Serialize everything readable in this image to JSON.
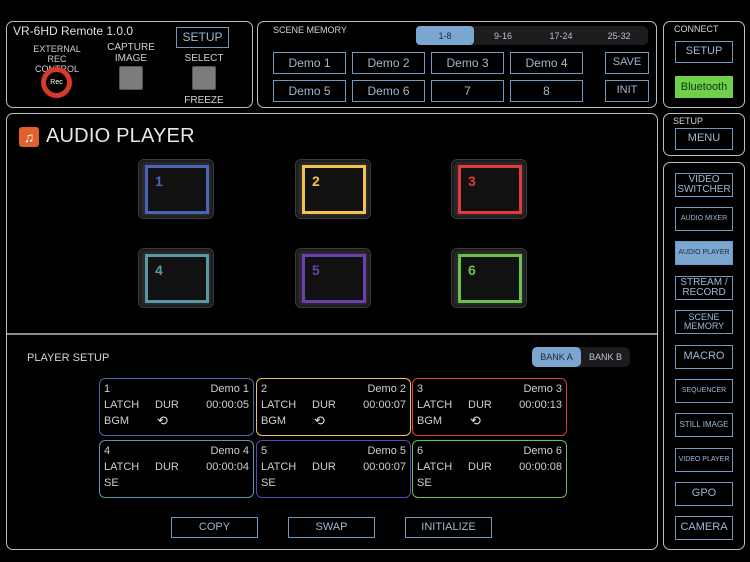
{
  "remote": {
    "title": "VR-6HD Remote 1.0.0",
    "setup_label": "SETUP",
    "external_rec_label_1": "EXTERNAL",
    "external_rec_label_2": "REC CONTROL",
    "rec_label": "Rec",
    "capture_label_1": "CAPTURE",
    "capture_label_2": "IMAGE",
    "select_label": "SELECT",
    "freeze_label": "FREEZE"
  },
  "scene_memory": {
    "title": "SCENE MEMORY",
    "tabs": [
      {
        "label": "1-8",
        "active": true
      },
      {
        "label": "9-16",
        "active": false
      },
      {
        "label": "17-24",
        "active": false
      },
      {
        "label": "25-32",
        "active": false
      }
    ],
    "scenes": [
      "Demo 1",
      "Demo 2",
      "Demo 3",
      "Demo 4",
      "Demo 5",
      "Demo 6",
      "7",
      "8"
    ],
    "save_label": "SAVE",
    "init_label": "INIT"
  },
  "connect": {
    "title": "CONNECT",
    "setup_label": "SETUP",
    "bluetooth_label": "Bluetooth",
    "bluetooth_color": "#6ed04b"
  },
  "setup_menu": {
    "title": "SETUP",
    "menu_label": "MENU"
  },
  "nav": {
    "items": [
      {
        "label": "VIDEO SWITCHER",
        "active": false
      },
      {
        "label": "AUDIO MIXER",
        "active": false
      },
      {
        "label": "AUDIO PLAYER",
        "active": true
      },
      {
        "label": "STREAM / RECORD",
        "active": false
      },
      {
        "label": "SCENE MEMORY",
        "active": false
      },
      {
        "label": "MACRO",
        "active": false
      },
      {
        "label": "SEQUENCER",
        "active": false
      },
      {
        "label": "STILL IMAGE",
        "active": false
      },
      {
        "label": "VIDEO PLAYER",
        "active": false
      },
      {
        "label": "GPO",
        "active": false
      },
      {
        "label": "CAMERA",
        "active": false
      }
    ]
  },
  "main": {
    "icon": "music-note-icon",
    "title": "AUDIO PLAYER",
    "pads": [
      {
        "num": "1",
        "color": "#4a63b8"
      },
      {
        "num": "2",
        "color": "#f2c14e"
      },
      {
        "num": "3",
        "color": "#e03a3a"
      },
      {
        "num": "4",
        "color": "#5a98a8"
      },
      {
        "num": "5",
        "color": "#6a3fb0"
      },
      {
        "num": "6",
        "color": "#6cc04a"
      }
    ],
    "player_setup": {
      "title": "PLAYER SETUP",
      "banks": [
        {
          "label": "BANK A",
          "active": true
        },
        {
          "label": "BANK B",
          "active": false
        }
      ],
      "slots": [
        {
          "num": "1",
          "name": "Demo 1",
          "mode": "LATCH",
          "dur_label": "DUR",
          "time": "00:00:05",
          "type": "BGM",
          "loop": true,
          "color": "#4a63b8"
        },
        {
          "num": "2",
          "name": "Demo 2",
          "mode": "LATCH",
          "dur_label": "DUR",
          "time": "00:00:07",
          "type": "BGM",
          "loop": true,
          "color": "#f2c14e"
        },
        {
          "num": "3",
          "name": "Demo 3",
          "mode": "LATCH",
          "dur_label": "DUR",
          "time": "00:00:13",
          "type": "BGM",
          "loop": true,
          "color": "#e03a3a"
        },
        {
          "num": "4",
          "name": "Demo 4",
          "mode": "LATCH",
          "dur_label": "DUR",
          "time": "00:00:04",
          "type": "SE",
          "loop": false,
          "color": "#5a98a8"
        },
        {
          "num": "5",
          "name": "Demo 5",
          "mode": "LATCH",
          "dur_label": "DUR",
          "time": "00:00:07",
          "type": "SE",
          "loop": false,
          "color": "#6a3fb0"
        },
        {
          "num": "6",
          "name": "Demo 6",
          "mode": "LATCH",
          "dur_label": "DUR",
          "time": "00:00:08",
          "type": "SE",
          "loop": false,
          "color": "#6cc04a"
        }
      ],
      "loop_glyph": "⟲",
      "actions": [
        "COPY",
        "SWAP",
        "INITIALIZE"
      ]
    }
  }
}
